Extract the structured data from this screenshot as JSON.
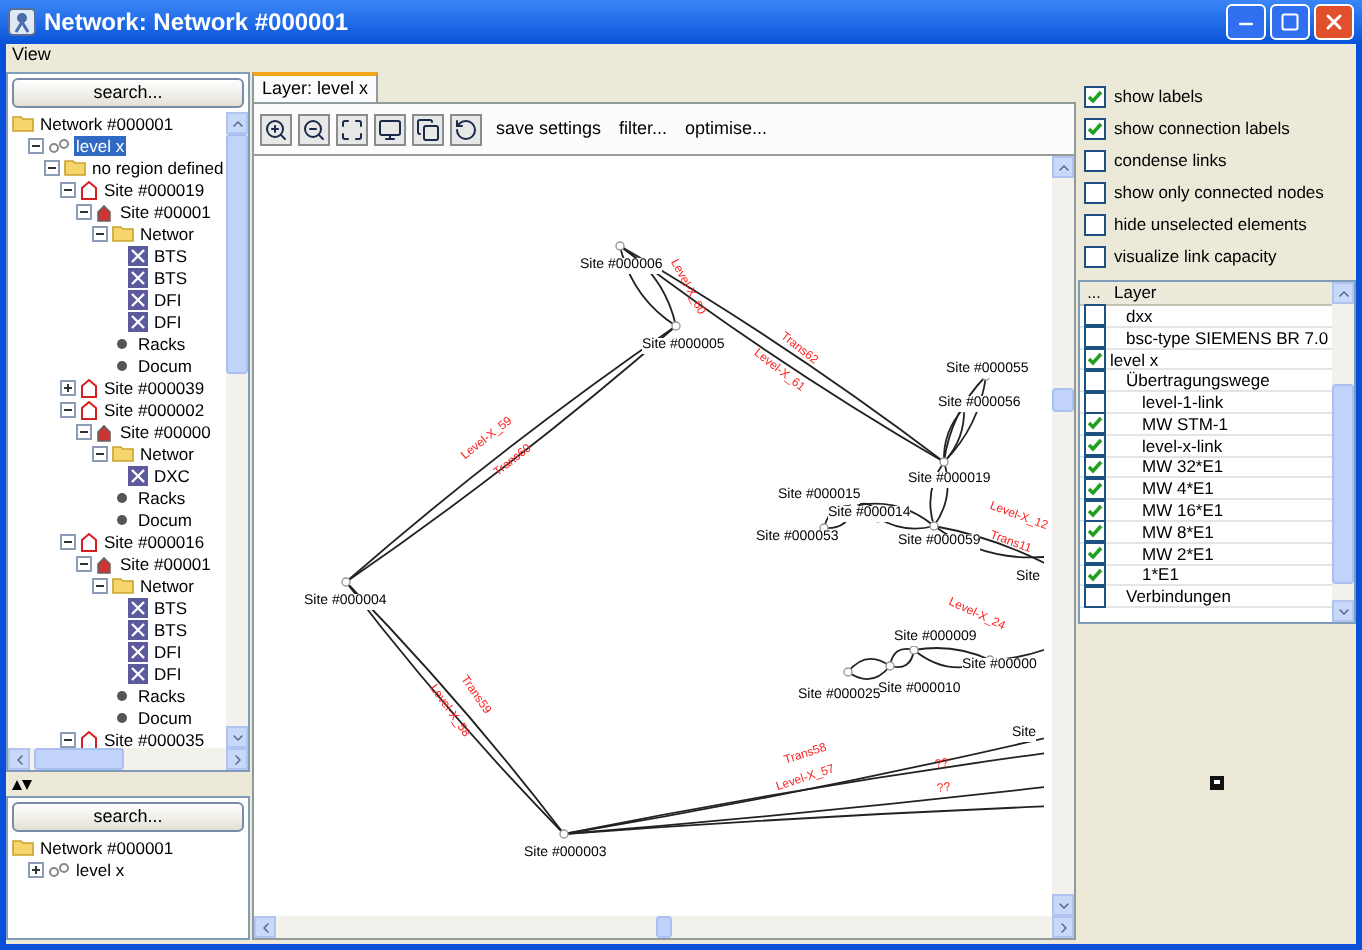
{
  "window": {
    "title": "Network: Network #000001"
  },
  "menu": [
    "View"
  ],
  "left_panel": {
    "search_button": "search...",
    "tree": [
      {
        "label": "Network #000001",
        "kind": "folder",
        "selected": false,
        "children": [
          {
            "label": "level x",
            "kind": "layer",
            "selected": true,
            "expanded": true,
            "children": [
              {
                "label": "no region defined",
                "kind": "folder",
                "selected": false,
                "expanded": true,
                "children": [
                  {
                    "label": "Site #000019",
                    "kind": "site",
                    "selected": false,
                    "expanded": true,
                    "children": [
                      {
                        "label": "Site #00001",
                        "kind": "station",
                        "selected": false,
                        "expanded": true,
                        "children": [
                          {
                            "label": "Networ",
                            "kind": "folder",
                            "selected": false,
                            "expanded": true,
                            "children": [
                              {
                                "label": "BTS",
                                "kind": "device",
                                "selected": false
                              },
                              {
                                "label": "BTS",
                                "kind": "device",
                                "selected": false
                              },
                              {
                                "label": "DFI",
                                "kind": "device",
                                "selected": false
                              },
                              {
                                "label": "DFI",
                                "kind": "device",
                                "selected": false
                              }
                            ]
                          },
                          {
                            "label": "Racks",
                            "kind": "bullet",
                            "selected": false
                          },
                          {
                            "label": "Docum",
                            "kind": "bullet",
                            "selected": false
                          }
                        ]
                      }
                    ]
                  },
                  {
                    "label": "Site #000039",
                    "kind": "site",
                    "selected": false,
                    "expanded": false
                  },
                  {
                    "label": "Site #000002",
                    "kind": "site",
                    "selected": false,
                    "expanded": true,
                    "children": [
                      {
                        "label": "Site #00000",
                        "kind": "station",
                        "selected": false,
                        "expanded": true,
                        "children": [
                          {
                            "label": "Networ",
                            "kind": "folder",
                            "selected": false,
                            "expanded": true,
                            "children": [
                              {
                                "label": "DXC",
                                "kind": "device",
                                "selected": false
                              }
                            ]
                          },
                          {
                            "label": "Racks",
                            "kind": "bullet",
                            "selected": false
                          },
                          {
                            "label": "Docum",
                            "kind": "bullet",
                            "selected": false
                          }
                        ]
                      }
                    ]
                  },
                  {
                    "label": "Site #000016",
                    "kind": "site",
                    "selected": false,
                    "expanded": true,
                    "children": [
                      {
                        "label": "Site #00001",
                        "kind": "station",
                        "selected": false,
                        "expanded": true,
                        "children": [
                          {
                            "label": "Networ",
                            "kind": "folder",
                            "selected": false,
                            "expanded": true,
                            "children": [
                              {
                                "label": "BTS",
                                "kind": "device",
                                "selected": false
                              },
                              {
                                "label": "BTS",
                                "kind": "device",
                                "selected": false
                              },
                              {
                                "label": "DFI",
                                "kind": "device",
                                "selected": false
                              },
                              {
                                "label": "DFI",
                                "kind": "device",
                                "selected": false
                              }
                            ]
                          },
                          {
                            "label": "Racks",
                            "kind": "bullet",
                            "selected": false
                          },
                          {
                            "label": "Docum",
                            "kind": "bullet",
                            "selected": false
                          }
                        ]
                      }
                    ]
                  },
                  {
                    "label": "Site #000035",
                    "kind": "site",
                    "selected": false,
                    "expanded": true
                  }
                ]
              }
            ]
          }
        ]
      }
    ]
  },
  "bottom_panel": {
    "search_button": "search...",
    "tree": [
      {
        "label": "Network #000001",
        "kind": "folder",
        "selected": false,
        "children": [
          {
            "label": "level x",
            "kind": "layer",
            "selected": false,
            "expanded": false
          }
        ]
      }
    ]
  },
  "tabs": [
    {
      "label": "Layer: level x",
      "selected": true
    }
  ],
  "toolbar": {
    "text_buttons": [
      "save settings",
      "filter...",
      "optimise..."
    ]
  },
  "graph": {
    "nodes": [
      "Site #000006",
      "Site #000005",
      "Site #000004",
      "Site #000003",
      "Site #000055",
      "Site #000056",
      "Site #000019",
      "Site #000015",
      "Site #000014",
      "Site #000053",
      "Site #000059",
      "Site",
      "Site #000009",
      "Site #000010",
      "Site #000025",
      "Site #00000",
      "Site"
    ],
    "links": [
      "Level-X_59",
      "Trans60",
      "Trans62",
      "Level-X_61",
      "Level-X_60",
      "Trans59",
      "Level-X_58",
      "Trans58",
      "Level-X_57",
      "??",
      "??",
      "Level-X_12",
      "Trans11",
      "Level-X_24"
    ]
  },
  "display_options": [
    {
      "label": "show labels",
      "checked": true
    },
    {
      "label": "show connection labels",
      "checked": true
    },
    {
      "label": "condense links",
      "checked": false
    },
    {
      "label": "show only connected nodes",
      "checked": false
    },
    {
      "label": "hide unselected elements",
      "checked": false
    },
    {
      "label": "visualize link capacity",
      "checked": false
    }
  ],
  "layer_table": {
    "columns": [
      "...",
      "Layer"
    ],
    "partial_rows": [
      {
        "label": "dxx",
        "checked": false
      },
      {
        "label": "bsc-type SIEMENS BR 7.0",
        "checked": false
      }
    ],
    "rows": [
      {
        "label": "level x",
        "checked": true,
        "children": [
          {
            "label": "Übertragungswege",
            "checked": false,
            "children": [
              {
                "label": "level-1-link",
                "checked": false
              },
              {
                "label": "MW STM-1",
                "checked": true
              },
              {
                "label": "level-x-link",
                "checked": true
              },
              {
                "label": "MW 32*E1",
                "checked": true
              },
              {
                "label": "MW 4*E1",
                "checked": true
              },
              {
                "label": "MW 16*E1",
                "checked": true
              },
              {
                "label": "MW 8*E1",
                "checked": true
              },
              {
                "label": "MW 2*E1",
                "checked": true
              },
              {
                "label": "1*E1",
                "checked": true
              }
            ]
          },
          {
            "label": "Verbindungen",
            "checked": false
          }
        ]
      }
    ]
  }
}
